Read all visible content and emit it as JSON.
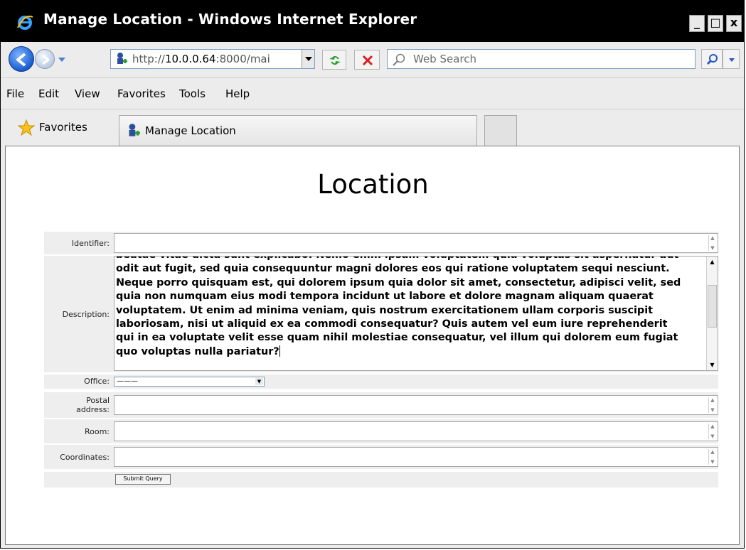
{
  "window": {
    "title": "Manage Location - Windows Internet Explorer",
    "min_label": "_",
    "max_label": "□",
    "close_label": "x"
  },
  "address": {
    "prefix": "http://",
    "host": "10.0.0.64",
    "rest": ":8000/mai"
  },
  "search": {
    "placeholder": "Web Search"
  },
  "menu": [
    "File",
    "Edit",
    "View",
    "Favorites",
    "Tools",
    "Help"
  ],
  "favorites": {
    "label": "Favorites",
    "tab_label": "Manage Location"
  },
  "page": {
    "heading": "Location",
    "identifier_label": "Identifier:",
    "identifier_value": "",
    "description_label": "Description:",
    "description_value": "beatae vitae dicta sunt explicabo. Nemo enim ipsam voluptatem quia voluptas sit aspernatur aut\nodit aut fugit, sed quia consequuntur magni dolores eos qui ratione voluptatem sequi nesciunt.\nNeque porro quisquam est, qui dolorem ipsum quia dolor sit amet, consectetur, adipisci velit, sed\nquia non numquam eius modi tempora incidunt ut labore et dolore magnam aliquam quaerat\nvoluptatem. Ut enim ad minima veniam, quis nostrum exercitationem ullam corporis suscipit\nlaboriosam, nisi ut aliquid ex ea commodi consequatur? Quis autem vel eum iure reprehenderit\nqui in ea voluptate velit esse quam nihil molestiae consequatur, vel illum qui dolorem eum fugiat\nquo voluptas nulla pariatur?",
    "office_label": "Office:",
    "office_selected": "———",
    "postal_label_1": "Postal",
    "postal_label_2": "address:",
    "postal_value": "",
    "room_label": "Room:",
    "room_value": "",
    "coordinates_label": "Coordinates:",
    "coordinates_value": "",
    "submit_label": "Submit Query"
  },
  "colors": {
    "titlebar": "#000000",
    "chrome": "#ececec",
    "form_row": "#eeeeee",
    "field_border": "#a8a8a8"
  }
}
